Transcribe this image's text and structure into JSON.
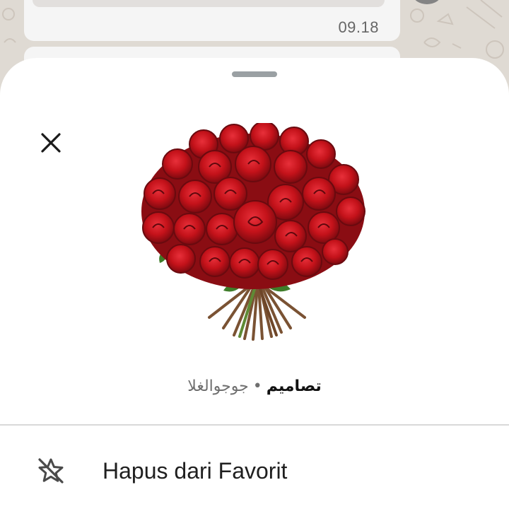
{
  "chat": {
    "message_time": "09.18"
  },
  "sheet": {
    "sticker": {
      "icon": "red-rose-bouquet-sticker",
      "pack_name": "تصاميم",
      "separator": "•",
      "author": "جوجوالغلا"
    },
    "actions": [
      {
        "icon": "star-off-icon",
        "label": "Hapus dari Favorit"
      }
    ]
  },
  "colors": {
    "sheet_bg": "#ffffff",
    "chat_bg": "#e9e3dc",
    "rose_red": "#c8141b",
    "leaf_green": "#3f7d2a",
    "text_primary": "#1f1f1f",
    "text_secondary": "#6f6f6f"
  }
}
